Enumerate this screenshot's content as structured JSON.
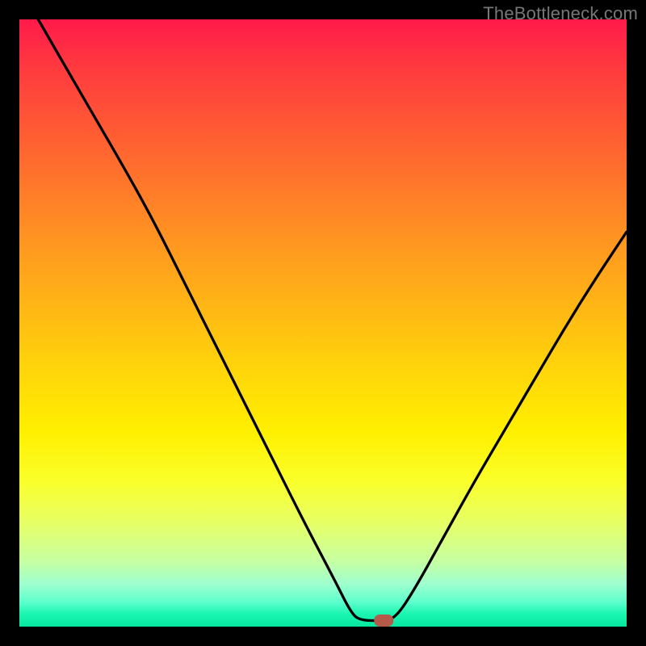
{
  "watermark": "TheBottleneck.com",
  "chart_data": {
    "type": "line",
    "title": "",
    "xlabel": "",
    "ylabel": "",
    "xlim": [
      0,
      100
    ],
    "ylim": [
      0,
      100
    ],
    "gradient_colors": {
      "top": "#ff1a4a",
      "upper_mid": "#ff9a1f",
      "mid": "#fff000",
      "lower_mid": "#c8ffa0",
      "bottom": "#06e79e"
    },
    "series": [
      {
        "name": "curve",
        "color": "#000000",
        "points": [
          {
            "x": 3.1,
            "y": 100.0
          },
          {
            "x": 10.0,
            "y": 88.0
          },
          {
            "x": 17.0,
            "y": 76.0
          },
          {
            "x": 22.0,
            "y": 67.0
          },
          {
            "x": 27.0,
            "y": 57.0
          },
          {
            "x": 32.0,
            "y": 47.0
          },
          {
            "x": 37.0,
            "y": 37.0
          },
          {
            "x": 42.0,
            "y": 27.0
          },
          {
            "x": 47.0,
            "y": 17.0
          },
          {
            "x": 52.0,
            "y": 7.5
          },
          {
            "x": 54.5,
            "y": 2.5
          },
          {
            "x": 56.0,
            "y": 1.0
          },
          {
            "x": 60.0,
            "y": 1.0
          },
          {
            "x": 62.0,
            "y": 1.5
          },
          {
            "x": 65.0,
            "y": 6.0
          },
          {
            "x": 70.0,
            "y": 15.0
          },
          {
            "x": 75.0,
            "y": 24.0
          },
          {
            "x": 80.0,
            "y": 32.5
          },
          {
            "x": 85.0,
            "y": 41.0
          },
          {
            "x": 90.0,
            "y": 49.5
          },
          {
            "x": 95.0,
            "y": 57.5
          },
          {
            "x": 100.0,
            "y": 65.0
          }
        ]
      }
    ],
    "marker": {
      "name": "optimal-point",
      "x": 60.0,
      "y": 1.0,
      "color": "#b55a4a"
    }
  }
}
